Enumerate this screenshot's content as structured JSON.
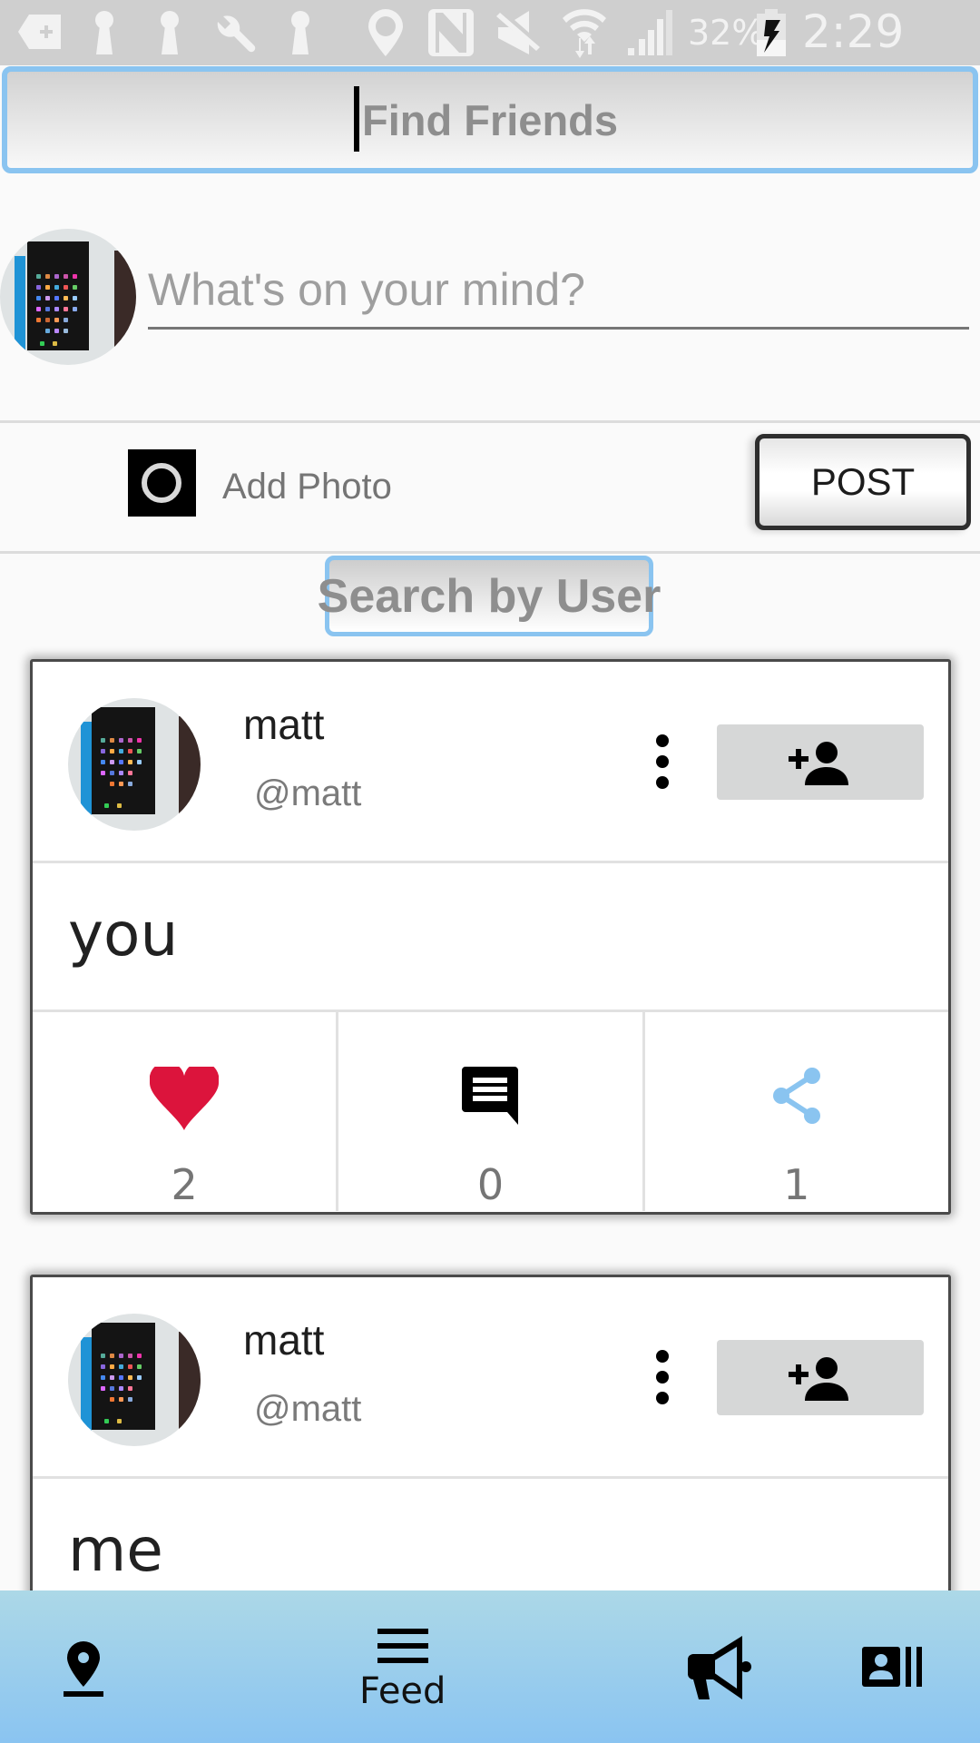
{
  "status_bar": {
    "battery_percent": "32%",
    "time": "2:29 PM",
    "icons": [
      "add-notification-icon",
      "keyhole-icon",
      "keyhole-icon",
      "wrench-icon",
      "keyhole-icon",
      "location-icon",
      "nfc-icon",
      "mute-icon",
      "wifi-icon",
      "signal-icon",
      "battery-charging-icon"
    ]
  },
  "header": {
    "find_friends_label": "Find Friends"
  },
  "composer": {
    "status_placeholder": "What's on your mind?",
    "status_value": "",
    "add_photo_label": "Add Photo",
    "post_label": "POST"
  },
  "search": {
    "search_by_user_label": "Search by User"
  },
  "feed": {
    "posts": [
      {
        "name": "matt",
        "handle": "@matt",
        "text": "you",
        "likes": "2",
        "comments": "0",
        "shares": "1"
      },
      {
        "name": "matt",
        "handle": "@matt",
        "text": "me"
      }
    ]
  },
  "bottom_nav": {
    "items": [
      {
        "icon": "place-icon",
        "label": ""
      },
      {
        "icon": "menu-icon",
        "label": "Feed"
      },
      {
        "icon": "megaphone-icon",
        "label": ""
      },
      {
        "icon": "contacts-icon",
        "label": ""
      }
    ]
  },
  "colors": {
    "accent_blue": "#8ac4f0",
    "like_red": "#dc143c",
    "share_blue": "#8ac4f0",
    "follow_button_bg": "#d6d7d7",
    "nav_gradient_top": "#acd8e7",
    "nav_gradient_bottom": "#8ac4f1"
  }
}
